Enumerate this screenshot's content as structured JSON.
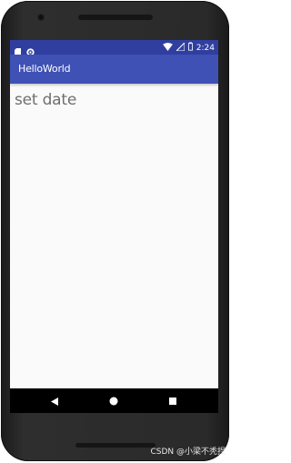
{
  "status_bar": {
    "time": "2:24",
    "left_icons": [
      "sd-card-icon",
      "settings-icon"
    ],
    "right_icons": [
      "wifi-icon",
      "signal-icon",
      "battery-icon"
    ]
  },
  "app_bar": {
    "title": "HelloWorld"
  },
  "content": {
    "text": "set date"
  },
  "nav_bar": {
    "buttons": [
      "back-icon",
      "home-icon",
      "recents-icon"
    ]
  },
  "watermark": {
    "text": "CSDN @小梁不秃捏"
  },
  "colors": {
    "status_bar": "#303f9f",
    "app_bar": "#3f51b5",
    "screen_bg": "#fafafa",
    "text": "#6f6f6f"
  }
}
